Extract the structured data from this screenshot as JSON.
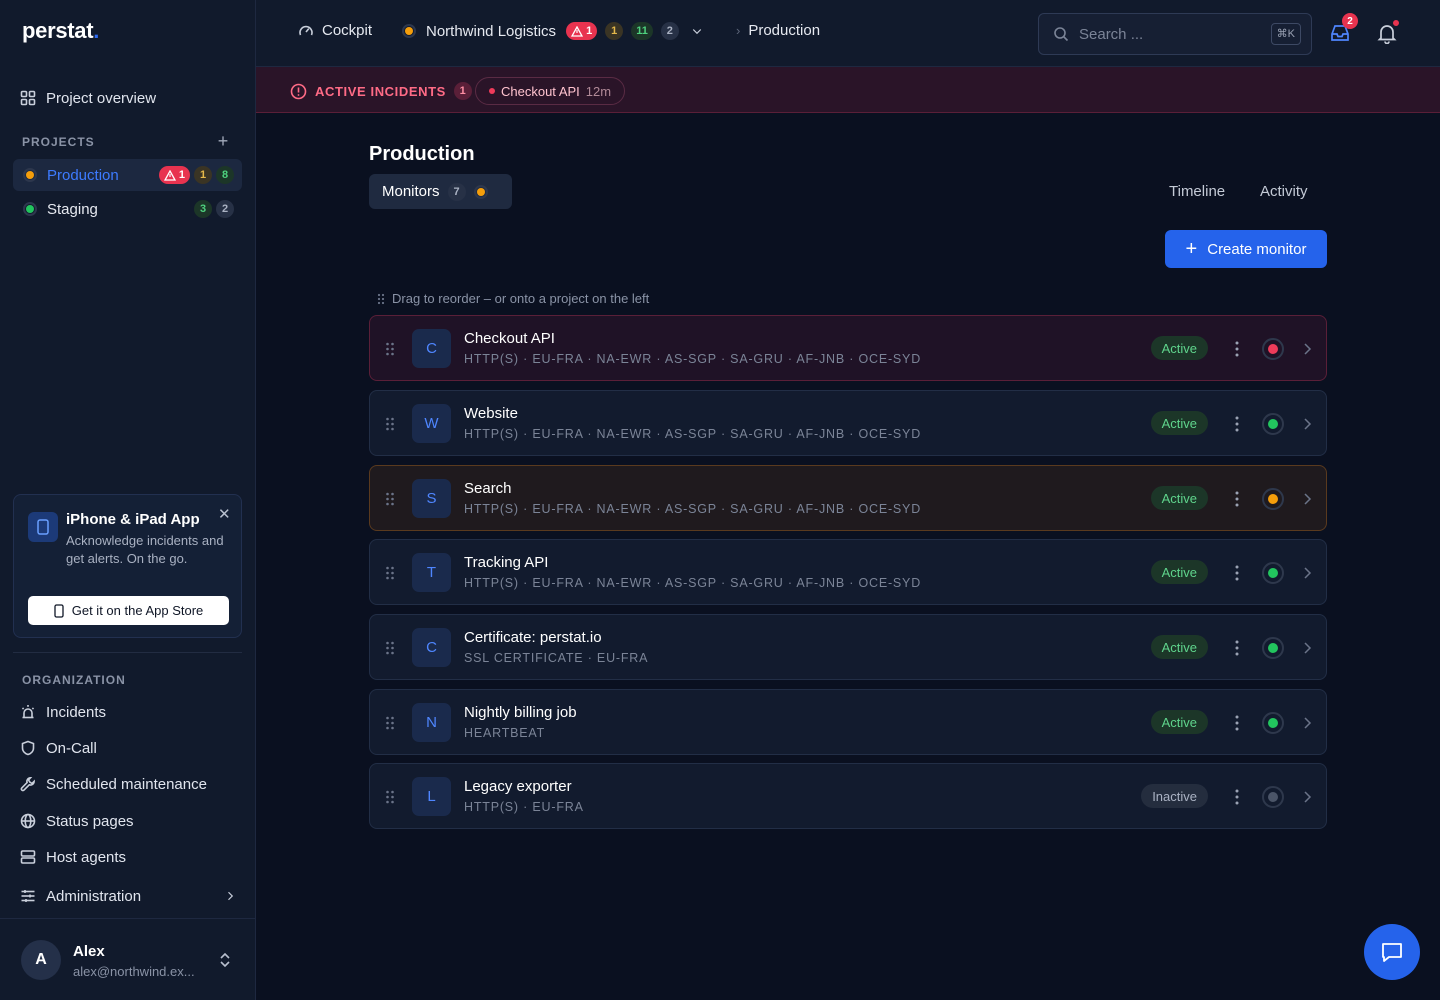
{
  "brand": {
    "name": "perstat",
    "dot": "."
  },
  "sidebar": {
    "overview": "Project overview",
    "projects_label": "PROJECTS",
    "projects": [
      {
        "name": "Production",
        "dot_color": "#f59e0b",
        "alerts": "1",
        "warn": "1",
        "ok": "8"
      },
      {
        "name": "Staging",
        "dot_color": "#22c55e",
        "ok": "3",
        "gray": "2"
      }
    ],
    "promo": {
      "title": "iPhone & iPad App",
      "text": "Acknowledge incidents and get alerts. On the go.",
      "button": "Get it on the App Store"
    },
    "org_label": "ORGANIZATION",
    "org_items": [
      "Incidents",
      "On-Call",
      "Scheduled maintenance",
      "Status pages",
      "Host agents",
      "Administration"
    ],
    "user": {
      "initial": "A",
      "name": "Alex",
      "email": "alex@northwind.ex..."
    }
  },
  "topbar": {
    "cockpit": "Cockpit",
    "org": "Northwind Logistics",
    "org_badges": {
      "alerts": "1",
      "warn": "1",
      "ok": "11",
      "gray": "2"
    },
    "current": "Production",
    "search_placeholder": "Search ...",
    "search_kbd": "⌘K",
    "inbox_count": "2"
  },
  "incidents": {
    "label": "ACTIVE INCIDENTS",
    "count": "1",
    "chip_name": "Checkout API",
    "chip_age": "12m"
  },
  "main": {
    "title": "Production",
    "tab_monitors": "Monitors",
    "tab_monitors_count": "7",
    "tab_timeline": "Timeline",
    "tab_activity": "Activity",
    "create": "Create monitor",
    "hint": "Drag to reorder – or onto a project on the left"
  },
  "monitors": [
    {
      "letter": "C",
      "name": "Checkout API",
      "meta": "HTTP(S) · EU-FRA · NA-EWR · AS-SGP · SA-GRU · AF-JNB · OCE-SYD",
      "state": "Active",
      "status_color": "#ef3b5a",
      "tone": "err"
    },
    {
      "letter": "W",
      "name": "Website",
      "meta": "HTTP(S) · EU-FRA · NA-EWR · AS-SGP · SA-GRU · AF-JNB · OCE-SYD",
      "state": "Active",
      "status_color": "#22c55e",
      "tone": ""
    },
    {
      "letter": "S",
      "name": "Search",
      "meta": "HTTP(S) · EU-FRA · NA-EWR · AS-SGP · SA-GRU · AF-JNB · OCE-SYD",
      "state": "Active",
      "status_color": "#f59e0b",
      "tone": "warn"
    },
    {
      "letter": "T",
      "name": "Tracking API",
      "meta": "HTTP(S) · EU-FRA · NA-EWR · AS-SGP · SA-GRU · AF-JNB · OCE-SYD",
      "state": "Active",
      "status_color": "#22c55e",
      "tone": ""
    },
    {
      "letter": "C",
      "name": "Certificate: perstat.io",
      "meta": "SSL CERTIFICATE · EU-FRA",
      "state": "Active",
      "status_color": "#22c55e",
      "tone": ""
    },
    {
      "letter": "N",
      "name": "Nightly billing job",
      "meta": "HEARTBEAT",
      "state": "Active",
      "status_color": "#22c55e",
      "tone": ""
    },
    {
      "letter": "L",
      "name": "Legacy exporter",
      "meta": "HTTP(S) · EU-FRA",
      "state": "Inactive",
      "status_color": "#4b5568",
      "tone": ""
    }
  ]
}
